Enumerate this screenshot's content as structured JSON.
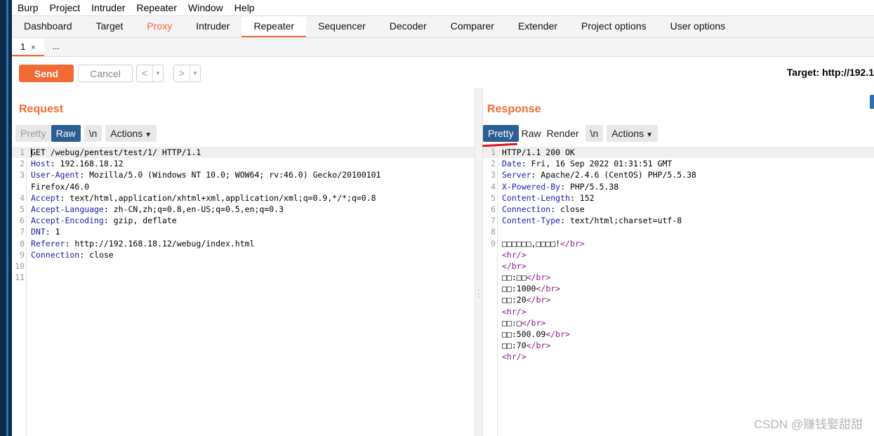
{
  "menu": [
    "Burp",
    "Project",
    "Intruder",
    "Repeater",
    "Window",
    "Help"
  ],
  "main_tabs": [
    "Dashboard",
    "Target",
    "Proxy",
    "Intruder",
    "Repeater",
    "Sequencer",
    "Decoder",
    "Comparer",
    "Extender",
    "Project options",
    "User options"
  ],
  "active_main_tab": "Repeater",
  "sub_tabs": {
    "first": "1",
    "close": "×",
    "more": "..."
  },
  "toolbar": {
    "send": "Send",
    "cancel": "Cancel",
    "back": "<",
    "forward": ">",
    "dropdown": "▾",
    "target": "Target: http://192.1"
  },
  "request": {
    "title": "Request",
    "buttons": {
      "pretty": "Pretty",
      "raw": "Raw",
      "newline": "\\n",
      "actions": "Actions"
    },
    "lines": [
      {
        "n": "1",
        "key": "",
        "val": "GET /webug/pentest/test/1/ HTTP/1.1"
      },
      {
        "n": "2",
        "key": "Host",
        "val": ": 192.168.18.12"
      },
      {
        "n": "3",
        "key": "User-Agent",
        "val": ": Mozilla/5.0 (Windows NT 10.0; WOW64; rv:46.0) Gecko/20100101"
      },
      {
        "n": "",
        "key": "",
        "val": "Firefox/46.0"
      },
      {
        "n": "4",
        "key": "Accept",
        "val": ": text/html,application/xhtml+xml,application/xml;q=0.9,*/*;q=0.8"
      },
      {
        "n": "5",
        "key": "Accept-Language",
        "val": ": zh-CN,zh;q=0.8,en-US;q=0.5,en;q=0.3"
      },
      {
        "n": "6",
        "key": "Accept-Encoding",
        "val": ": gzip, deflate"
      },
      {
        "n": "7",
        "key": "DNT",
        "val": ": 1"
      },
      {
        "n": "8",
        "key": "Referer",
        "val": ": http://192.168.18.12/webug/index.html"
      },
      {
        "n": "9",
        "key": "Connection",
        "val": ": close"
      },
      {
        "n": "10",
        "key": "",
        "val": ""
      },
      {
        "n": "11",
        "key": "",
        "val": ""
      }
    ]
  },
  "response": {
    "title": "Response",
    "buttons": {
      "pretty": "Pretty",
      "raw": "Raw",
      "render": "Render",
      "newline": "\\n",
      "actions": "Actions"
    },
    "lines": [
      {
        "n": "1",
        "type": "plain",
        "text": "HTTP/1.1 200 OK"
      },
      {
        "n": "2",
        "type": "header",
        "key": "Date",
        "val": ": Fri, 16 Sep 2022 01:31:51 GMT"
      },
      {
        "n": "3",
        "type": "header",
        "key": "Server",
        "val": ": Apache/2.4.6 (CentOS) PHP/5.5.38"
      },
      {
        "n": "4",
        "type": "header",
        "key": "X-Powered-By",
        "val": ": PHP/5.5.38"
      },
      {
        "n": "5",
        "type": "header",
        "key": "Content-Length",
        "val": ": 152"
      },
      {
        "n": "6",
        "type": "header",
        "key": "Connection",
        "val": ": close"
      },
      {
        "n": "7",
        "type": "header",
        "key": "Content-Type",
        "val": ": text/html;charset=utf-8"
      },
      {
        "n": "8",
        "type": "plain",
        "text": ""
      },
      {
        "n": "9",
        "type": "html",
        "text": "□□□□□□,□□□□!",
        "tag": "</br>"
      },
      {
        "n": "",
        "type": "html",
        "text": "",
        "tag": "<hr/>"
      },
      {
        "n": "",
        "type": "html",
        "text": "",
        "tag": "</br>"
      },
      {
        "n": "",
        "type": "html",
        "text": "□□:□□",
        "tag": "</br>"
      },
      {
        "n": "",
        "type": "html",
        "text": "□□:1000",
        "tag": "</br>"
      },
      {
        "n": "",
        "type": "html",
        "text": "□□:20",
        "tag": "</br>"
      },
      {
        "n": "",
        "type": "html",
        "text": "",
        "tag": "<hr/>"
      },
      {
        "n": "",
        "type": "html",
        "text": "□□:□",
        "tag": "</br>"
      },
      {
        "n": "",
        "type": "html",
        "text": "□□:500.09",
        "tag": "</br>"
      },
      {
        "n": "",
        "type": "html",
        "text": "□□:70",
        "tag": "</br>"
      },
      {
        "n": "",
        "type": "html",
        "text": "",
        "tag": "<hr/>"
      }
    ]
  },
  "watermark": "CSDN @赚钱娶甜甜",
  "colors": {
    "accent": "#f26a34",
    "active_button": "#2b5f93",
    "header_key": "#1b1baa",
    "html_tag": "#8a188a",
    "annotation": "#e0101a"
  }
}
